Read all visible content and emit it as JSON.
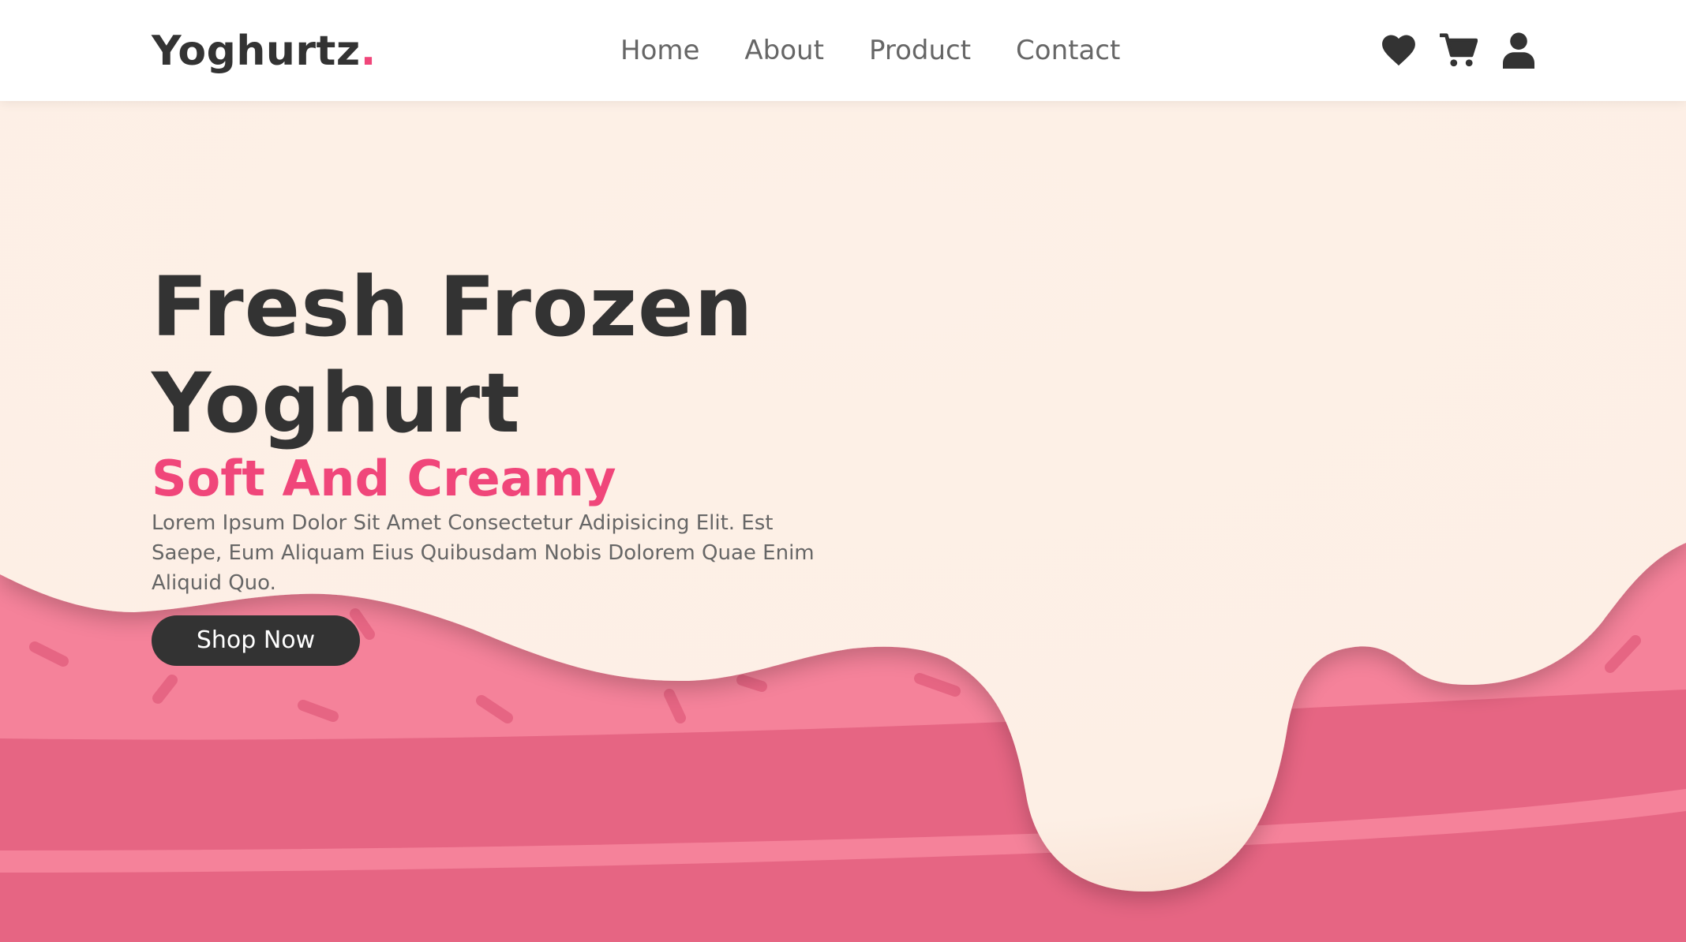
{
  "brand": {
    "name": "Yoghurtz",
    "dot": "."
  },
  "nav": {
    "items": [
      {
        "label": "Home"
      },
      {
        "label": "About"
      },
      {
        "label": "Product"
      },
      {
        "label": "Contact"
      }
    ]
  },
  "header_icons": {
    "wishlist": "heart-icon",
    "cart": "cart-icon",
    "account": "user-icon"
  },
  "hero": {
    "title_line1": "Fresh Frozen",
    "title_line2": "Yoghurt",
    "subtitle": "Soft And Creamy",
    "description": "Lorem Ipsum Dolor Sit Amet Consectetur Adipisicing Elit. Est Saepe, Eum Aliquam Eius Quibusdam Nobis Dolorem Quae Enim Aliquid Quo.",
    "cta_label": "Shop Now"
  },
  "colors": {
    "accent": "#f0467a",
    "dark": "#333333",
    "cream": "#fdf0e7",
    "pink_light": "#f5829a",
    "pink_dark": "#e66583"
  }
}
